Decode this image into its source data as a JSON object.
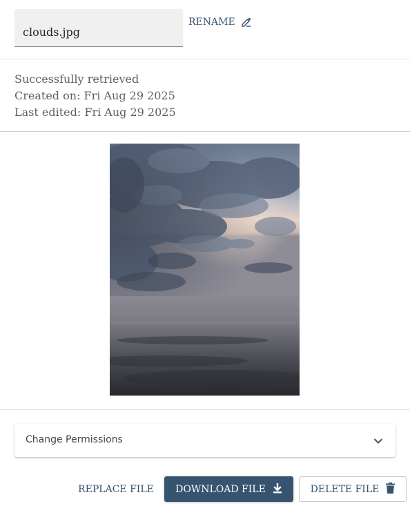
{
  "file": {
    "name": "clouds.jpg",
    "rename_label": "RENAME"
  },
  "info": {
    "status": "Successfully retrieved",
    "created": "Created on: Fri Aug 29 2025",
    "edited": "Last edited: Fri Aug 29 2025"
  },
  "permissions": {
    "label": "Change Permissions"
  },
  "actions": {
    "replace_label": "REPLACE FILE",
    "download_label": "DOWNLOAD FILE",
    "delete_label": "DELETE FILE"
  },
  "icons": {
    "rename": "pencil-icon",
    "chevron": "chevron-down-icon",
    "download": "download-icon",
    "delete": "trash-icon"
  },
  "colors": {
    "accent": "#36546f",
    "field_bg": "#f0f0f0",
    "divider": "#dddddd"
  }
}
